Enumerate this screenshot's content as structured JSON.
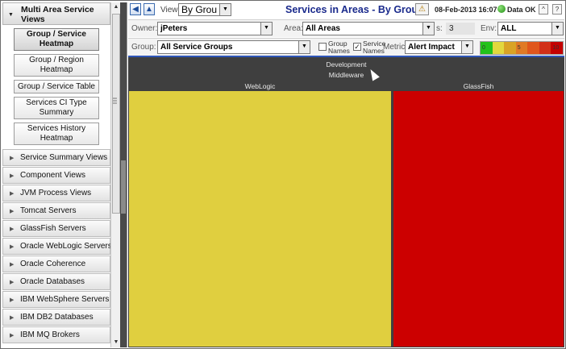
{
  "sidebar": {
    "header": "Multi Area Service Views",
    "subitems": [
      {
        "label": "Group / Service Heatmap",
        "active": true
      },
      {
        "label": "Group / Region Heatmap"
      },
      {
        "label": "Group / Service Table"
      },
      {
        "label": "Services CI Type Summary"
      },
      {
        "label": "Services History Heatmap"
      }
    ],
    "groups": [
      "Service Summary Views",
      "Component Views",
      "JVM Process Views",
      "Tomcat Servers",
      "GlassFish Servers",
      "Oracle WebLogic Servers",
      "Oracle Coherence",
      "Oracle Databases",
      "IBM WebSphere Servers",
      "IBM DB2 Databases",
      "IBM MQ Brokers"
    ]
  },
  "toolbar": {
    "view_label": "View:",
    "view_value": "By Grou",
    "title": "Services in Areas - By Group",
    "timestamp": "08-Feb-2013 16:07",
    "status": "Data OK",
    "btn_up": "^",
    "btn_help": "?"
  },
  "filters": {
    "owner_label": "Owner:",
    "owner_value": "jPeters",
    "area_label": "Area:",
    "area_value": "All Areas",
    "count_label": "s:",
    "count_value": "3",
    "env_label": "Env:",
    "env_value": "ALL",
    "group_label": "Group:",
    "group_value": "All Service Groups",
    "group_names_label": "Group Names",
    "group_names_checked": false,
    "service_names_label": "Service Names",
    "service_names_checked": true,
    "metric_label": "Metric:",
    "metric_value": "Alert Impact",
    "legend_colors": [
      "#22c21b",
      "#e2d83e",
      "#d9a325",
      "#e07a25",
      "#e0561c",
      "#d23018",
      "#c40000"
    ],
    "legend_labels": [
      "0",
      "",
      "",
      "5",
      "",
      "",
      "10"
    ]
  },
  "heatmap": {
    "area": "Development",
    "group": "Middleware",
    "services": [
      {
        "name": "WebLogic",
        "color": "#e0cf3f"
      },
      {
        "name": "GlassFish",
        "color": "#cc0000"
      }
    ]
  }
}
